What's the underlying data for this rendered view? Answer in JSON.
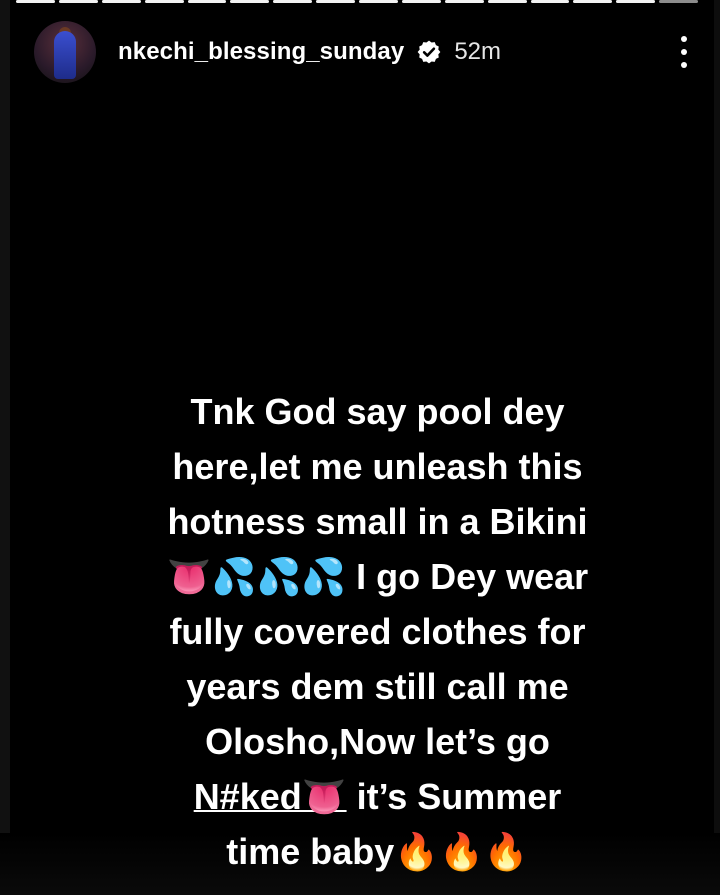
{
  "story": {
    "progress_segments": 16,
    "current_segment": 16,
    "username": "nkechi_blessing_sunday",
    "time_ago": "52m",
    "verified": true,
    "icons": {
      "verified": "verified-badge-icon",
      "more": "more-options-icon"
    },
    "caption_lines": [
      "Tnk God say pool dey",
      "here,let me unleash this",
      "hotness small in a Bikini",
      "👅💦💦💦 I go Dey wear",
      "fully covered clothes for",
      "years dem still call me",
      "Olosho,Now let’s go",
      "N#ked👅 it’s Summer",
      "time baby🔥🔥🔥"
    ],
    "caption_underlined_word": "N#ked👅"
  }
}
